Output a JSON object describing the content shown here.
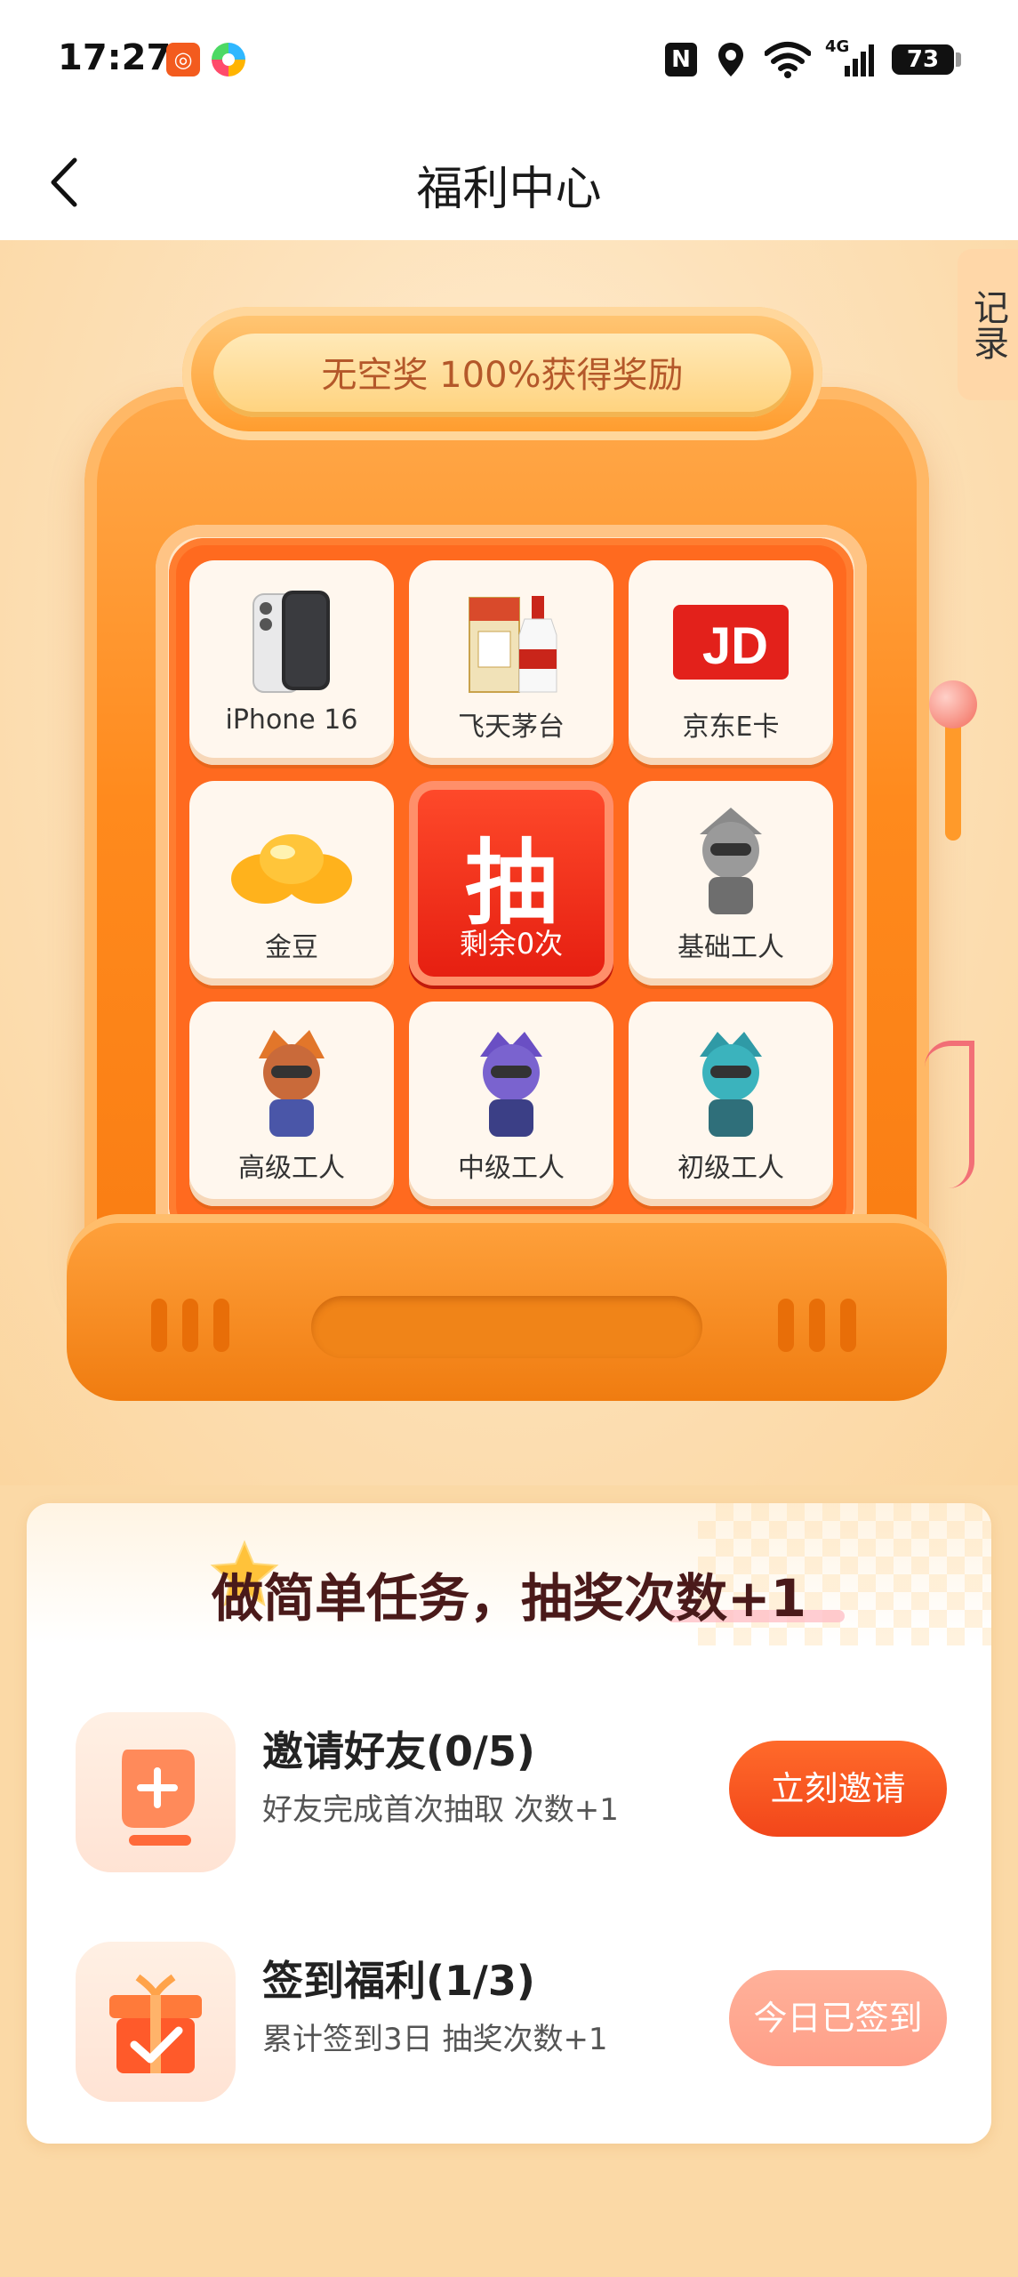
{
  "status_bar": {
    "time": "17:27",
    "network": "4G",
    "battery": "73"
  },
  "nav": {
    "title": "福利中心"
  },
  "records_tab": "记录",
  "banner": "无空奖 100%获得奖励",
  "prizes": [
    {
      "label": "iPhone 16",
      "icon": "phone-icon"
    },
    {
      "label": "飞天茅台",
      "icon": "liquor-icon"
    },
    {
      "label": "京东E卡",
      "icon": "jd-card-icon"
    },
    {
      "label": "金豆",
      "icon": "gold-bean-icon"
    },
    {
      "label": "基础工人",
      "icon": "basic-worker-icon"
    },
    {
      "label": "高级工人",
      "icon": "senior-worker-icon"
    },
    {
      "label": "中级工人",
      "icon": "intermediate-worker-icon"
    },
    {
      "label": "初级工人",
      "icon": "junior-worker-icon"
    }
  ],
  "draw_button": {
    "char": "抽",
    "remaining": "剩余0次"
  },
  "tasks": {
    "title": "做简单任务，抽奖次数+1",
    "items": [
      {
        "name": "邀请好友(0/5)",
        "desc": "好友完成首次抽取 次数+1",
        "button": "立刻邀请",
        "icon": "invite-friend-icon"
      },
      {
        "name": "签到福利(1/3)",
        "desc": "累计签到3日 抽奖次数+1",
        "button": "今日已签到",
        "icon": "gift-check-icon"
      }
    ]
  },
  "colors": {
    "accent": "#f2461a",
    "machine": "#ff8a1d",
    "background": "#fbd9a6"
  }
}
